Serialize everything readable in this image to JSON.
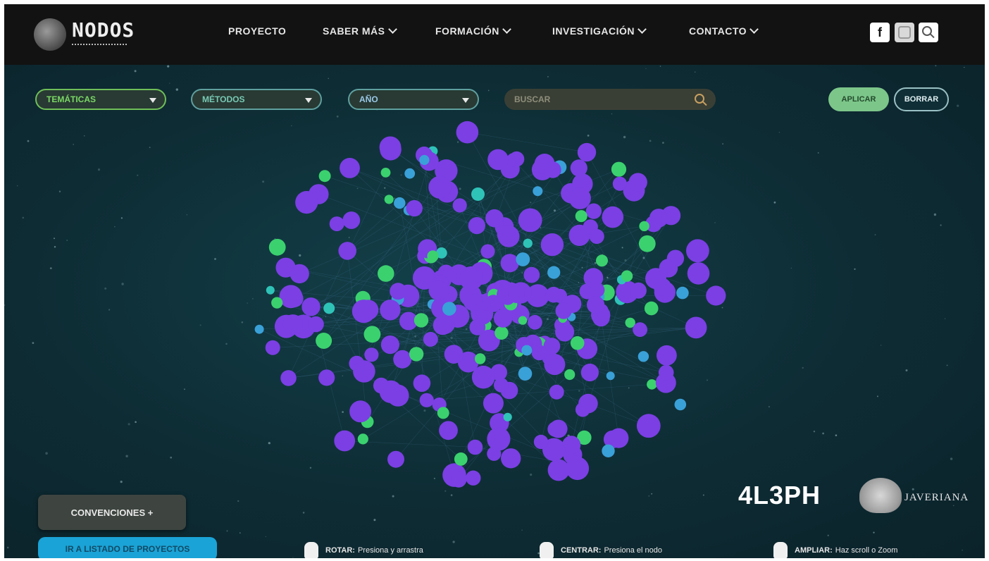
{
  "header": {
    "logo_text": "NODOS",
    "nav": [
      "PROYECTO",
      "SABER MÁS",
      "FORMACIÓN",
      "INVESTIGACIÓN",
      "CONTACTO"
    ],
    "social": {
      "facebook": "f"
    }
  },
  "filters": {
    "tematicas": "TEMÁTICAS",
    "metodos": "MÉTODOS",
    "ano": "AÑO",
    "search_placeholder": "BUSCAR"
  },
  "actions": {
    "aplicar": "APLICAR",
    "borrar": "BORRAR"
  },
  "graph": {
    "node_colors": {
      "purple": "#7b3fe4",
      "green": "#3bd16f",
      "blue": "#3aa0d8",
      "teal": "#2fc3b8"
    }
  },
  "footer": {
    "convenciones": "CONVENCIONES +",
    "listado": "IR A LISTADO DE PROYECTOS",
    "brand_4l3ph": "4L3PH",
    "javeriana": "JAVERIANA",
    "hints": [
      {
        "key": "ROTAR:",
        "text": "Presiona y arrastra"
      },
      {
        "key": "CENTRAR:",
        "text": "Presiona el nodo"
      },
      {
        "key": "AMPLIAR:",
        "text": "Haz scroll o Zoom"
      }
    ]
  }
}
